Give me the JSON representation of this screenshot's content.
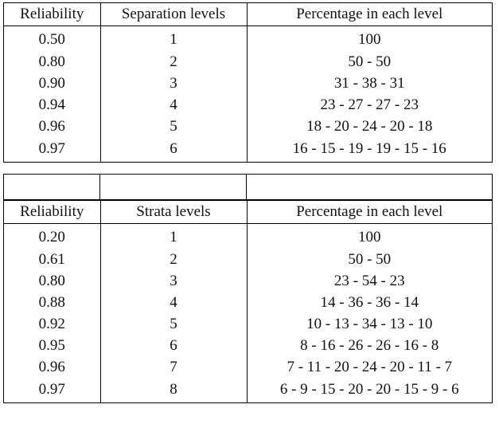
{
  "document": {
    "kind": "two-part statistical reference table",
    "background_color": "#ffffff",
    "border_color": "#000000",
    "text_color": "#111018"
  },
  "tables": [
    {
      "id": "separation",
      "columns": [
        "Reliability",
        "Separation levels",
        "Percentage in each level"
      ],
      "rows": [
        {
          "reliability": "0.50",
          "levels": "1",
          "percentage": "100"
        },
        {
          "reliability": "0.80",
          "levels": "2",
          "percentage": "50 - 50"
        },
        {
          "reliability": "0.90",
          "levels": "3",
          "percentage": "31 - 38 - 31"
        },
        {
          "reliability": "0.94",
          "levels": "4",
          "percentage": "23 - 27 - 27 - 23"
        },
        {
          "reliability": "0.96",
          "levels": "5",
          "percentage": "18 - 20 - 24 - 20 - 18"
        },
        {
          "reliability": "0.97",
          "levels": "6",
          "percentage": "16 - 15 - 19 - 19 - 15 - 16"
        }
      ]
    },
    {
      "id": "strata",
      "columns": [
        "Reliability",
        "Strata  levels",
        "Percentage in each level"
      ],
      "rows": [
        {
          "reliability": "0.20",
          "levels": "1",
          "percentage": "100"
        },
        {
          "reliability": "0.61",
          "levels": "2",
          "percentage": "50 - 50"
        },
        {
          "reliability": "0.80",
          "levels": "3",
          "percentage": "23 - 54 - 23"
        },
        {
          "reliability": "0.88",
          "levels": "4",
          "percentage": "14 - 36 - 36 - 14"
        },
        {
          "reliability": "0.92",
          "levels": "5",
          "percentage": "10 - 13 - 34 - 13 - 10"
        },
        {
          "reliability": "0.95",
          "levels": "6",
          "percentage": "8 - 16 - 26 - 26 - 16 - 8"
        },
        {
          "reliability": "0.96",
          "levels": "7",
          "percentage": "7 - 11 - 20 - 24 - 20 - 11 - 7"
        },
        {
          "reliability": "0.97",
          "levels": "8",
          "percentage": "6 - 9 - 15 - 20 - 20 - 15 - 9 - 6"
        }
      ]
    }
  ]
}
